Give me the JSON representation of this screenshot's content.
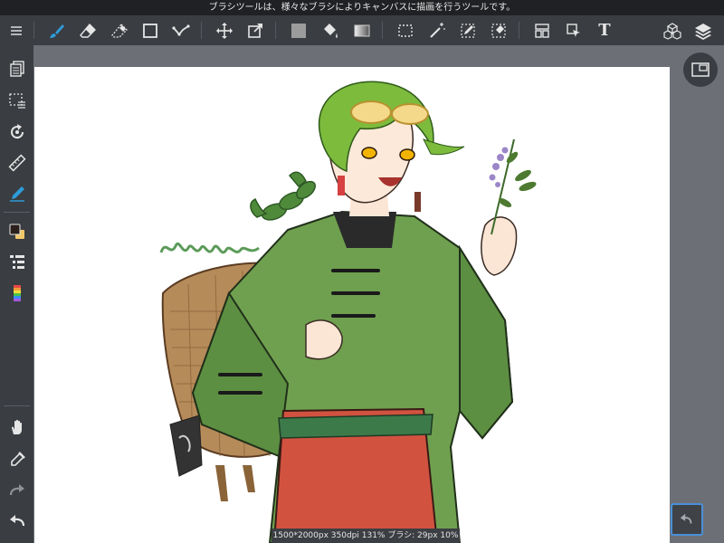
{
  "status_bar": {
    "hint": "ブラシツールは、様々なブラシによりキャンバスに描画を行うツールです。"
  },
  "toolbar": {
    "left_tools": [
      {
        "name": "menu-icon",
        "state": "normal"
      },
      {
        "name": "brush-icon",
        "state": "active"
      },
      {
        "name": "eraser-icon",
        "state": "normal"
      },
      {
        "name": "smudge-icon",
        "state": "normal"
      },
      {
        "name": "shape-icon",
        "state": "normal"
      },
      {
        "name": "polyline-icon",
        "state": "normal"
      },
      {
        "name": "move-icon",
        "state": "normal"
      },
      {
        "name": "transform-icon",
        "state": "normal"
      },
      {
        "name": "fill-icon",
        "state": "normal"
      },
      {
        "name": "bucket-icon",
        "state": "normal"
      },
      {
        "name": "gradient-icon",
        "state": "normal"
      },
      {
        "name": "select-icon",
        "state": "normal"
      },
      {
        "name": "magic-wand-icon",
        "state": "normal"
      },
      {
        "name": "select-pen-icon",
        "state": "normal"
      },
      {
        "name": "select-eraser-icon",
        "state": "normal"
      },
      {
        "name": "frame-icon",
        "state": "normal"
      },
      {
        "name": "operation-icon",
        "state": "normal"
      },
      {
        "name": "text-icon",
        "state": "normal"
      }
    ],
    "text_tool_glyph": "T",
    "right_tools": [
      "material-icon",
      "layers-icon"
    ]
  },
  "sidebar": {
    "items": [
      "pages-icon",
      "selection-icon",
      "rotate-icon",
      "ruler-icon",
      "snap-pen-icon",
      "color-swatch-icon",
      "layer-list-icon",
      "color-palette-icon",
      "hand-icon",
      "eyedropper-icon",
      "redo-icon",
      "undo-icon"
    ]
  },
  "colors": {
    "accent": "#2e9bd8",
    "toolbar_bg": "#3a3d42",
    "canvas_bg": "#ffffff",
    "workspace_bg": "#6c7076",
    "highlight_border": "#4a90d9"
  },
  "canvas_info": "1500*2000px 350dpi 131% ブラシ: 29px 10%",
  "navigator": "navigator-icon",
  "quick_undo": "quick-undo-icon"
}
